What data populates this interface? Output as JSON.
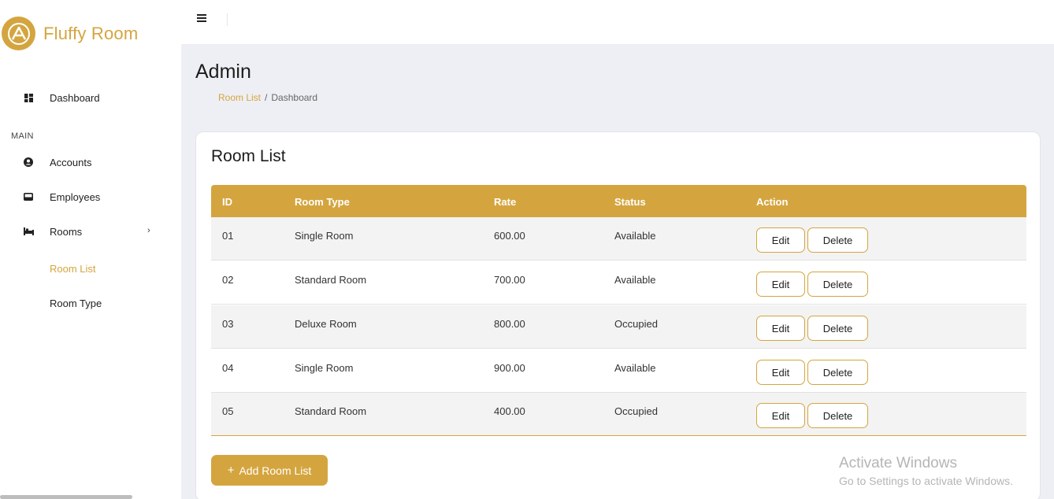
{
  "brand": {
    "name": "Fluffy Room",
    "logo_icon": "brand-logo-icon",
    "accent": "#d4a53f"
  },
  "sidebar": {
    "dashboard": "Dashboard",
    "section_main": "MAIN",
    "accounts": "Accounts",
    "employees": "Employees",
    "rooms": "Rooms",
    "room_list": "Room List",
    "room_type": "Room Type"
  },
  "header": {
    "title": "Admin",
    "breadcrumb": {
      "link": "Room List",
      "current": "Dashboard"
    }
  },
  "card": {
    "title": "Room List",
    "columns": {
      "id": "ID",
      "room_type": "Room Type",
      "rate": "Rate",
      "status": "Status",
      "action": "Action"
    },
    "rows": [
      {
        "id": "01",
        "room_type": "Single Room",
        "rate": "600.00",
        "status": "Available"
      },
      {
        "id": "02",
        "room_type": "Standard Room",
        "rate": "700.00",
        "status": "Available"
      },
      {
        "id": "03",
        "room_type": "Deluxe Room",
        "rate": "800.00",
        "status": "Occupied"
      },
      {
        "id": "04",
        "room_type": "Single Room",
        "rate": "900.00",
        "status": "Available"
      },
      {
        "id": "05",
        "room_type": "Standard Room",
        "rate": "400.00",
        "status": "Occupied"
      }
    ],
    "edit_label": "Edit",
    "delete_label": "Delete",
    "add_button": "Add Room List"
  },
  "watermark": {
    "title": "Activate Windows",
    "subtitle": "Go to Settings to activate Windows."
  }
}
